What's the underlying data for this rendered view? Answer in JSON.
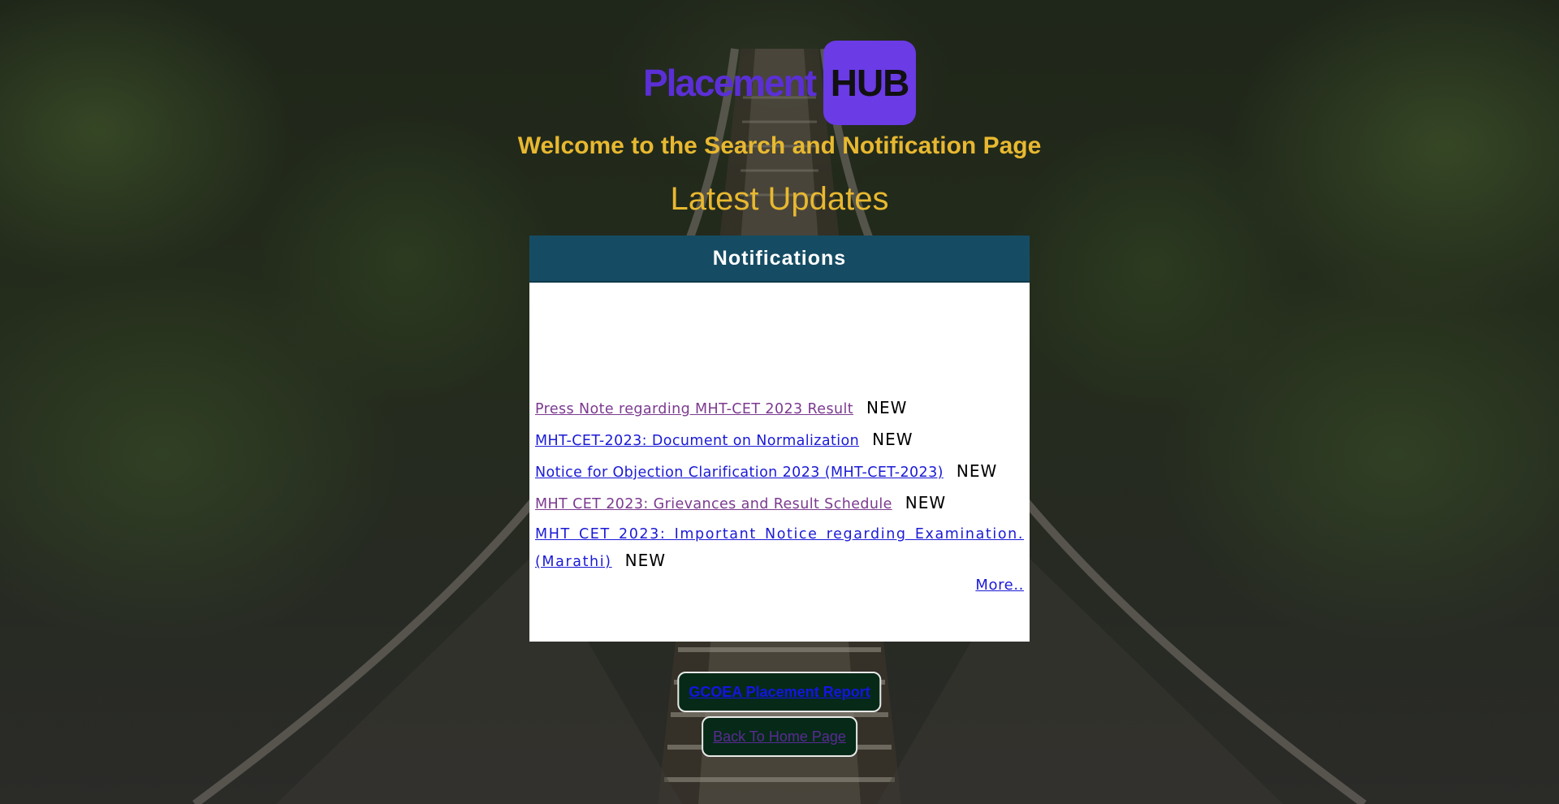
{
  "logo": {
    "text": "Placement",
    "badge": "HUB"
  },
  "welcome": "Welcome to the Search and Notification Page",
  "latest_heading": "Latest Updates",
  "notifications": {
    "header": "Notifications",
    "items": [
      {
        "label": "Press Note regarding MHT-CET 2023 Result",
        "badge": "NEW",
        "visited": true
      },
      {
        "label": "MHT-CET-2023: Document on Normalization",
        "badge": "NEW",
        "visited": false
      },
      {
        "label": "Notice for Objection Clarification 2023 (MHT-CET-2023)",
        "badge": "NEW",
        "visited": false
      },
      {
        "label": "MHT CET 2023: Grievances and Result Schedule",
        "badge": "NEW",
        "visited": true
      },
      {
        "label": "MHT CET 2023: Important Notice regarding Examination. (Marathi)",
        "badge": "NEW",
        "visited": false
      }
    ],
    "more_label": "More.."
  },
  "buttons": {
    "report": "GCOEA Placement Report",
    "home": "Back To Home Page"
  },
  "colors": {
    "brand_purple": "#6b3be6",
    "heading_gold": "#e8b830",
    "panel_header": "#154c63",
    "button_bg": "#062a17"
  }
}
